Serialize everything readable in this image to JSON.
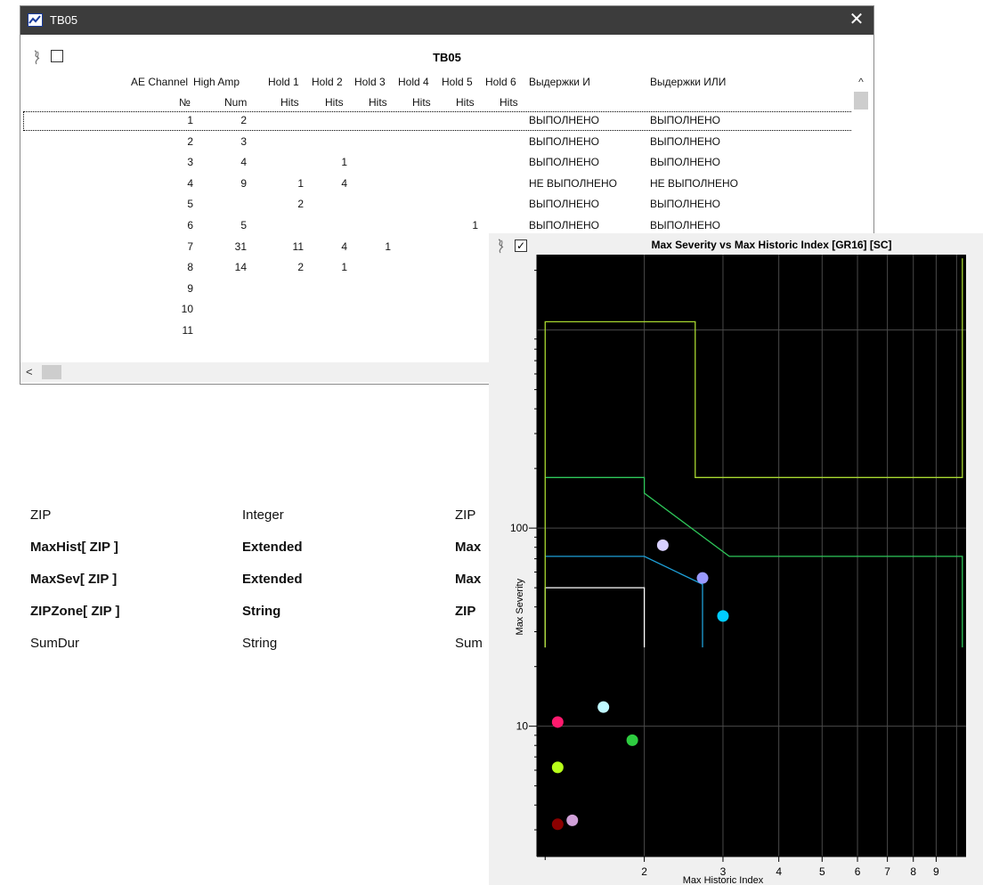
{
  "window": {
    "title": "TB05",
    "close_glyph": "✕",
    "icon": "chart-window-icon"
  },
  "table": {
    "title": "TB05",
    "headers_row1": [
      "AE Channel",
      "High Amp",
      "Hold 1",
      "Hold 2",
      "Hold 3",
      "Hold 4",
      "Hold 5",
      "Hold 6",
      "Выдержки И",
      "Выдержки ИЛИ"
    ],
    "headers_row2": [
      "№",
      "Num",
      "Hits",
      "Hits",
      "Hits",
      "Hits",
      "Hits",
      "Hits",
      "",
      ""
    ],
    "rows": [
      [
        "1",
        "2",
        "",
        "",
        "",
        "",
        "",
        "",
        "ВЫПОЛНЕНО",
        "ВЫПОЛНЕНО"
      ],
      [
        "2",
        "3",
        "",
        "",
        "",
        "",
        "",
        "",
        "ВЫПОЛНЕНО",
        "ВЫПОЛНЕНО"
      ],
      [
        "3",
        "4",
        "",
        "1",
        "",
        "",
        "",
        "",
        "ВЫПОЛНЕНО",
        "ВЫПОЛНЕНО"
      ],
      [
        "4",
        "9",
        "1",
        "4",
        "",
        "",
        "",
        "",
        "НЕ ВЫПОЛНЕНО",
        "НЕ ВЫПОЛНЕНО"
      ],
      [
        "5",
        "",
        "2",
        "",
        "",
        "",
        "",
        "",
        "ВЫПОЛНЕНО",
        "ВЫПОЛНЕНО"
      ],
      [
        "6",
        "5",
        "",
        "",
        "",
        "",
        "1",
        "",
        "ВЫПОЛНЕНО",
        "ВЫПОЛНЕНО"
      ],
      [
        "7",
        "31",
        "11",
        "4",
        "1",
        "",
        "",
        "",
        "",
        ""
      ],
      [
        "8",
        "14",
        "2",
        "1",
        "",
        "",
        "",
        "",
        "",
        ""
      ],
      [
        "9",
        "",
        "",
        "",
        "",
        "",
        "",
        "",
        "",
        ""
      ],
      [
        "10",
        "",
        "",
        "",
        "",
        "",
        "",
        "",
        "",
        ""
      ],
      [
        "11",
        "",
        "",
        "",
        "",
        "",
        "",
        "",
        "",
        ""
      ]
    ],
    "selected_row": 0
  },
  "fields": [
    {
      "name": "ZIP",
      "type": "Integer",
      "extra": "ZIP",
      "bold": false
    },
    {
      "name": "MaxHist[ ZIP ]",
      "type": "Extended",
      "extra": "Max",
      "bold": true
    },
    {
      "name": "MaxSev[ ZIP ]",
      "type": "Extended",
      "extra": "Max",
      "bold": true
    },
    {
      "name": "ZIPZone[ ZIP ]",
      "type": "String",
      "extra": "ZIP",
      "bold": true
    },
    {
      "name": "SumDur",
      "type": "String",
      "extra": "Sum",
      "bold": false
    }
  ],
  "chart_data": {
    "type": "scatter",
    "title": "Max Severity vs Max Historic Index [GR16] [SC]",
    "xlabel": "Max Historic Index",
    "ylabel": "Max Severity",
    "x_scale": "log",
    "y_scale": "log",
    "xlim": [
      1.15,
      10.5
    ],
    "ylim": [
      2.2,
      2400
    ],
    "x_tick_labels": [
      "2",
      "3",
      "4",
      "5",
      "6",
      "7",
      "8",
      "9"
    ],
    "y_tick_labels": [
      "10",
      "100"
    ],
    "grid": true,
    "checkbox_checked": true,
    "points": [
      {
        "x": 1.28,
        "y": 10.5,
        "color": "#ff1a6e"
      },
      {
        "x": 1.28,
        "y": 6.2,
        "color": "#b8ff1a"
      },
      {
        "x": 1.28,
        "y": 3.2,
        "color": "#8b0000"
      },
      {
        "x": 1.38,
        "y": 3.35,
        "color": "#d0a0d8"
      },
      {
        "x": 1.62,
        "y": 12.5,
        "color": "#bff8ff"
      },
      {
        "x": 1.88,
        "y": 8.5,
        "color": "#2ecc40"
      },
      {
        "x": 2.2,
        "y": 82,
        "color": "#d8d0ff"
      },
      {
        "x": 2.7,
        "y": 56,
        "color": "#9a9aff"
      },
      {
        "x": 3.0,
        "y": 36,
        "color": "#00ccff"
      }
    ],
    "zone_colors": [
      "#ffffff",
      "#1ea0d8",
      "#2ec85a",
      "#a8d830"
    ]
  }
}
